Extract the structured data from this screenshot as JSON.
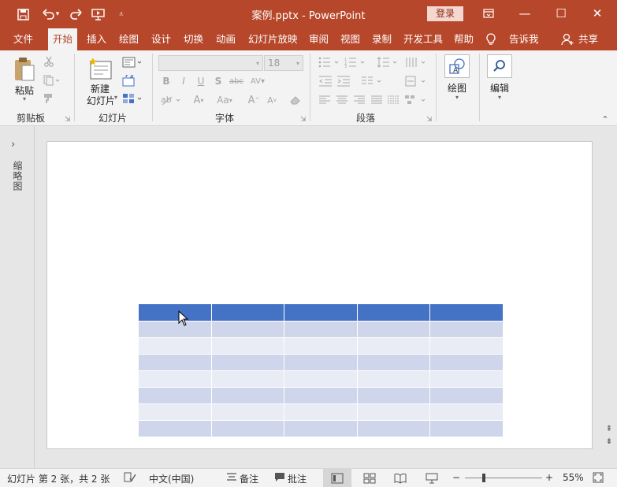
{
  "titlebar": {
    "title": "案例.pptx  -  PowerPoint",
    "login_label": "登录",
    "minimize_glyph": "—",
    "restore_glyph": "☐",
    "close_glyph": "✕"
  },
  "tabs": [
    {
      "label": "文件"
    },
    {
      "label": "开始"
    },
    {
      "label": "插入"
    },
    {
      "label": "绘图"
    },
    {
      "label": "设计"
    },
    {
      "label": "切换"
    },
    {
      "label": "动画"
    },
    {
      "label": "幻灯片放映"
    },
    {
      "label": "审阅"
    },
    {
      "label": "视图"
    },
    {
      "label": "录制"
    },
    {
      "label": "开发工具"
    },
    {
      "label": "帮助"
    },
    {
      "label": "告诉我"
    },
    {
      "label": "共享"
    }
  ],
  "ribbon": {
    "clipboard": {
      "paste_label": "粘贴",
      "group_label": "剪贴板"
    },
    "slides": {
      "new_slide_label_1": "新建",
      "new_slide_label_2": "幻灯片",
      "group_label": "幻灯片"
    },
    "font": {
      "font_size": "18",
      "group_label": "字体"
    },
    "paragraph": {
      "group_label": "段落"
    },
    "drawing": {
      "label": "绘图"
    },
    "editing": {
      "label": "编辑"
    }
  },
  "thumbnail_pane": {
    "label": "缩略图"
  },
  "table": {
    "columns": 5,
    "body_rows": 7
  },
  "statusbar": {
    "slide_info": "幻灯片 第 2 张，共 2 张",
    "language": "中文(中国)",
    "notes_label": "备注",
    "comments_label": "批注",
    "zoom_minus": "−",
    "zoom_plus": "+",
    "zoom_percent": "55%"
  },
  "colors": {
    "accent": "#b7472a",
    "table_header": "#4472c4",
    "table_band_dark": "#cfd5ea",
    "table_band_light": "#e9ebf5"
  }
}
